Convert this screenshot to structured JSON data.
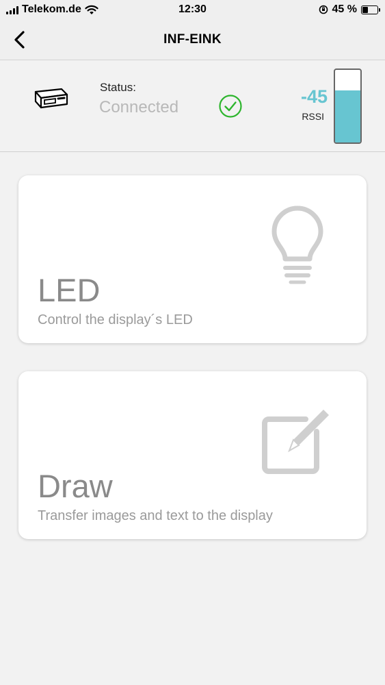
{
  "statusbar": {
    "carrier": "Telekom.de",
    "time": "12:30",
    "battery": "45 %",
    "battery_level": 0.45
  },
  "navbar": {
    "title": "INF-EINK",
    "back_icon": "chevron-left-icon"
  },
  "device": {
    "icon": "eink-device-icon",
    "status_label": "Status:",
    "status_value": "Connected",
    "status_icon": "check-circle-icon",
    "status_color": "#2db52d",
    "rssi_value": "-45",
    "rssi_label": "RSSI",
    "rssi_color": "#67c5d1",
    "signal_level": 0.72
  },
  "cards": [
    {
      "title": "LED",
      "subtitle": "Control the display´s LED",
      "icon": "lightbulb-icon"
    },
    {
      "title": "Draw",
      "subtitle": "Transfer images and text to the display",
      "icon": "edit-pencil-icon"
    }
  ]
}
